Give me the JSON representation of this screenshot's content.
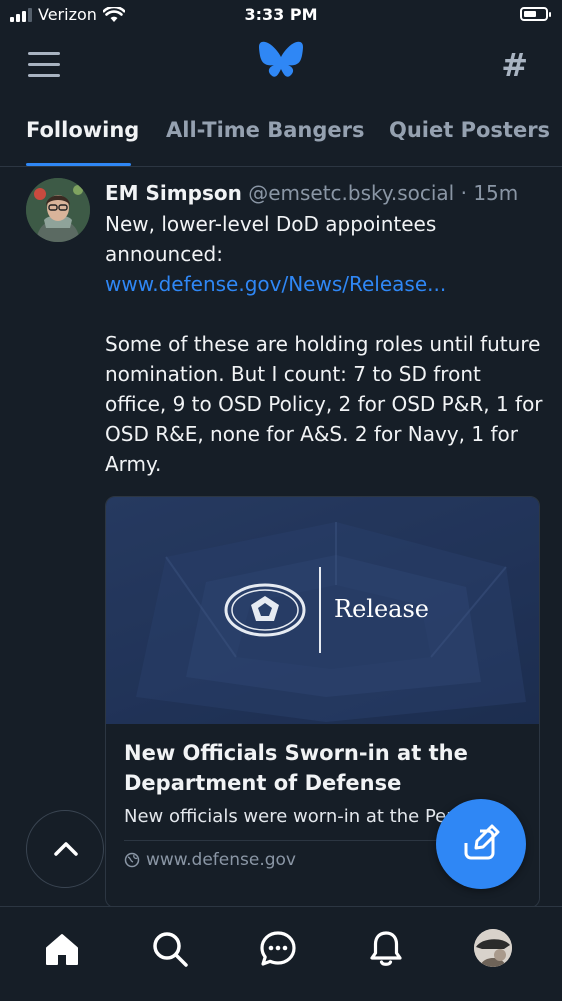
{
  "status_bar": {
    "carrier": "Verizon",
    "time": "3:33 PM"
  },
  "colors": {
    "background": "#161e27",
    "accent": "#2f87f5",
    "muted_text": "#8a96a5"
  },
  "top_nav": {
    "menu_icon": "hamburger-menu-icon",
    "logo_icon": "butterfly-logo-icon",
    "feeds_icon": "hash-icon"
  },
  "tabs": [
    {
      "label": "Following",
      "active": true
    },
    {
      "label": "All-Time Bangers",
      "active": false
    },
    {
      "label": "Quiet Posters",
      "active": false
    }
  ],
  "post": {
    "author": "EM Simpson",
    "handle": "@emsetc.bsky.social",
    "separator": "·",
    "age": "15m",
    "text_before_link": "New, lower-level DoD appointees announced: ",
    "link_text": "www.defense.gov/News/Release...",
    "text_after_link": "\n\nSome of these are holding roles until future nomination. But I count: 7 to SD front office, 9 to OSD Policy, 2 for OSD P&R, 1 for OSD R&E, none for A&S. 2 for Navy, 1 for Army.",
    "embed": {
      "image_label": "Release",
      "title": "New Officials Sworn-in at the Department of Defense",
      "description": "New officials were worn-in at the Pentagon.",
      "domain": "www.defense.gov"
    }
  },
  "floating": {
    "scroll_top_icon": "chevron-up-icon",
    "compose_icon": "compose-icon"
  },
  "bottom_bar": [
    {
      "name": "home-icon"
    },
    {
      "name": "search-icon"
    },
    {
      "name": "chat-icon"
    },
    {
      "name": "bell-icon"
    },
    {
      "name": "profile-avatar"
    }
  ]
}
